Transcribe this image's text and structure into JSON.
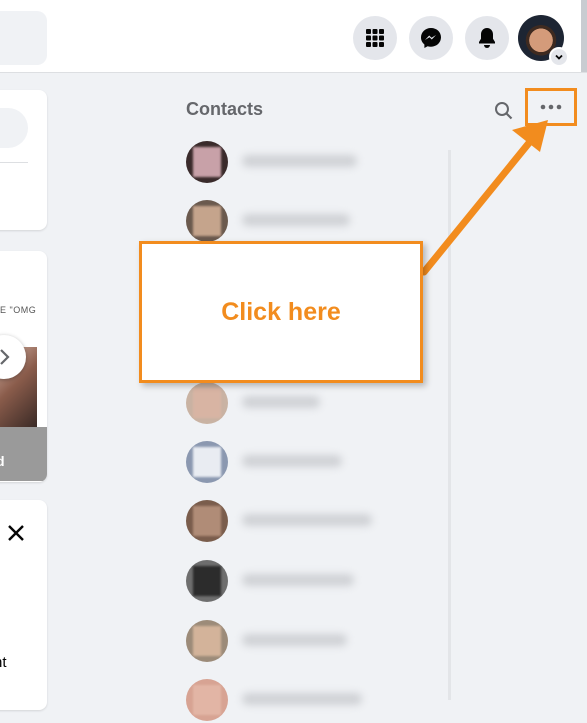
{
  "header": {
    "icons": [
      "menu-grid-icon",
      "messenger-icon",
      "notifications-bell-icon",
      "account-avatar",
      "chevron-down-icon"
    ]
  },
  "left_column": {
    "story_text_fragment": "E \"OMG",
    "story_caption_fragment": "d",
    "card_text_fragment": "nt"
  },
  "contacts": {
    "title": "Contacts",
    "search_icon": "search-icon",
    "more_icon": "more-options-icon",
    "contact_count_visible": 10
  },
  "annotation": {
    "text": "Click here",
    "color": "#f28c1e"
  },
  "colors": {
    "page_bg": "#f0f2f5",
    "header_bg": "#ffffff",
    "icon_button_bg": "#e4e6eb",
    "accent_annotation": "#f28c1e"
  }
}
